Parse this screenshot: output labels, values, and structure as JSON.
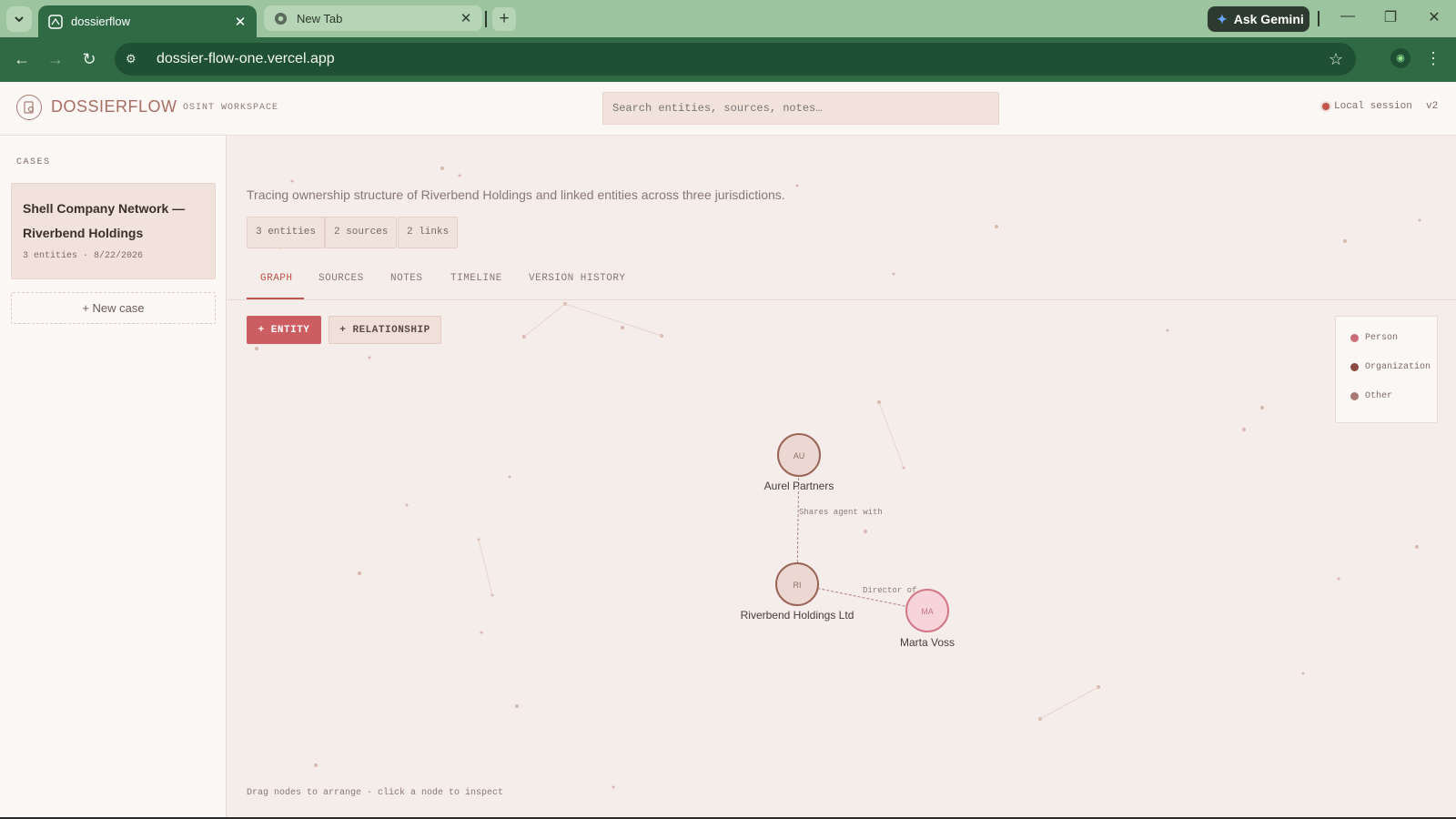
{
  "browser": {
    "tabs": [
      {
        "title": "dossierflow",
        "active": true
      },
      {
        "title": "New Tab",
        "active": false
      }
    ],
    "ask_gemini": "Ask Gemini",
    "url": "dossier-flow-one.vercel.app"
  },
  "header": {
    "brand": "DOSSIERFLOW",
    "subtitle": "OSINT WORKSPACE",
    "search_placeholder": "Search entities, sources, notes…",
    "session": "Local session",
    "version": "v2"
  },
  "sidebar": {
    "cases_label": "CASES",
    "cases": [
      {
        "title": "Shell Company Network — Riverbend Holdings",
        "meta": "3 entities · 8/22/2026"
      }
    ],
    "new_case": "+ New case"
  },
  "main": {
    "description": "Tracing ownership structure of Riverbend Holdings and linked entities across three jurisdictions.",
    "chips": [
      "3 entities",
      "2 sources",
      "2 links"
    ],
    "tabs": [
      "GRAPH",
      "SOURCES",
      "NOTES",
      "TIMELINE",
      "VERSION HISTORY"
    ],
    "active_tab": "GRAPH",
    "add_entity": "+ ENTITY",
    "add_relationship": "+ RELATIONSHIP",
    "hint": "Drag nodes to arrange · click a node to inspect"
  },
  "legend": [
    {
      "label": "Person",
      "color": "#cc6d7a"
    },
    {
      "label": "Organization",
      "color": "#8a4a40"
    },
    {
      "label": "Other",
      "color": "#a87a72"
    }
  ],
  "graph": {
    "nodes": [
      {
        "initials": "AU",
        "label": "Aurel Partners",
        "type": "Organization"
      },
      {
        "initials": "RI",
        "label": "Riverbend Holdings Ltd",
        "type": "Organization"
      },
      {
        "initials": "MA",
        "label": "Marta Voss",
        "type": "Person"
      }
    ],
    "edges": [
      {
        "label": "Shares agent with"
      },
      {
        "label": "Director of"
      }
    ]
  }
}
